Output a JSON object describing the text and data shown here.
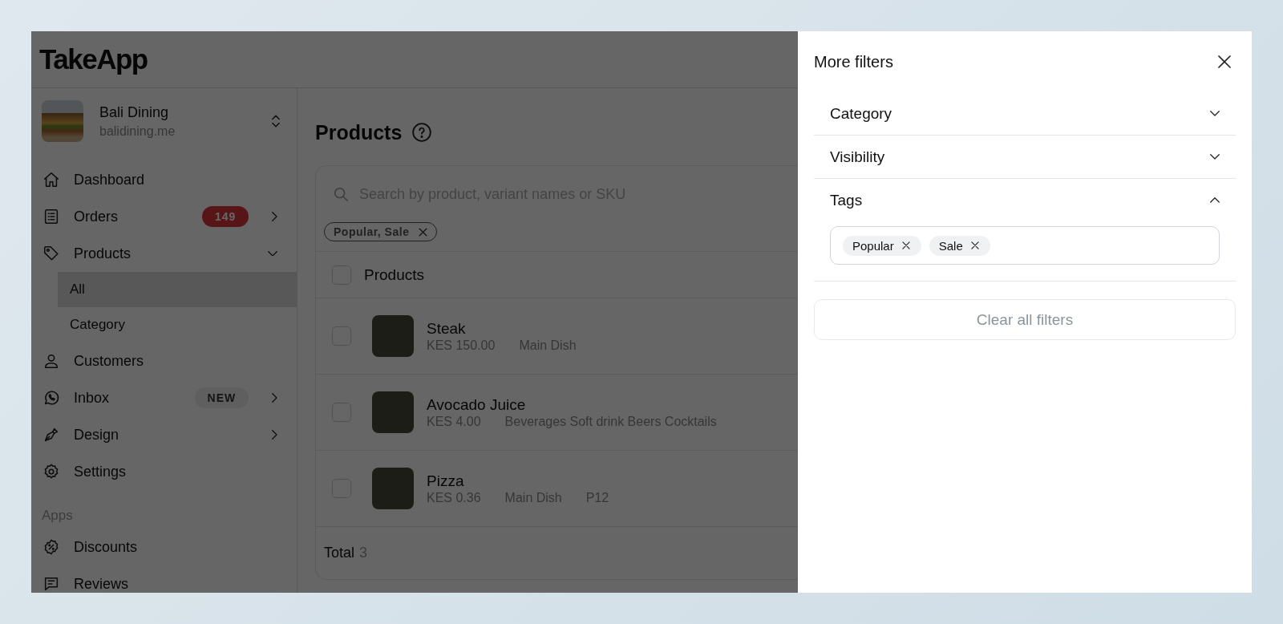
{
  "header": {
    "logo": "TakeApp"
  },
  "store": {
    "name": "Bali Dining",
    "domain": "balidining.me"
  },
  "sidebar": {
    "items": [
      {
        "label": "Dashboard",
        "kind": "link"
      },
      {
        "label": "Orders",
        "kind": "group",
        "expanded": false,
        "badge": {
          "text": "149",
          "kind": "count"
        }
      },
      {
        "label": "Products",
        "kind": "group",
        "expanded": true,
        "children": [
          {
            "label": "All",
            "selected": true
          },
          {
            "label": "Category",
            "selected": false
          }
        ]
      },
      {
        "label": "Customers",
        "kind": "link"
      },
      {
        "label": "Inbox",
        "kind": "group",
        "expanded": false,
        "badge": {
          "text": "NEW",
          "kind": "new"
        }
      },
      {
        "label": "Design",
        "kind": "group",
        "expanded": false
      },
      {
        "label": "Settings",
        "kind": "link"
      }
    ],
    "section_title": "Apps",
    "app_items": [
      {
        "label": "Discounts"
      },
      {
        "label": "Reviews"
      }
    ]
  },
  "page": {
    "title": "Products",
    "search": {
      "placeholder": "Search by product, variant names or SKU"
    },
    "active_filter": "Popular, Sale",
    "table": {
      "columns": [
        "Products"
      ],
      "header_checked": false,
      "rows": [
        {
          "name": "Steak",
          "price": "KES 150.00",
          "tags": [
            "Main Dish"
          ],
          "checked": false
        },
        {
          "name": "Avocado Juice",
          "price": "KES 4.00",
          "tags": [
            "Beverages Soft drink Beers Cocktails"
          ],
          "checked": false
        },
        {
          "name": "Pizza",
          "price": "KES 0.36",
          "tags": [
            "Main Dish",
            "P12"
          ],
          "checked": false
        }
      ]
    },
    "total_label": "Total",
    "total_value": "3"
  },
  "drawer": {
    "title": "More filters",
    "sections": [
      {
        "label": "Category",
        "expanded": false
      },
      {
        "label": "Visibility",
        "expanded": false
      },
      {
        "label": "Tags",
        "expanded": true,
        "chips": [
          "Popular",
          "Sale"
        ]
      }
    ],
    "clear_button": "Clear all filters"
  }
}
